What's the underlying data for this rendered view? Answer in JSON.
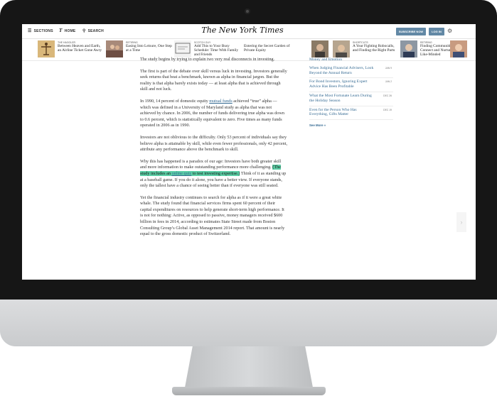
{
  "topbar": {
    "sections_label": "SECTIONS",
    "home_label": "HOME",
    "search_label": "SEARCH",
    "logo_text": "The New York Times",
    "subscribe_label": "SUBSCRIBE NOW",
    "login_label": "LOG IN"
  },
  "ribbon": [
    {
      "kicker": "THE HAGGLER",
      "headline": "Between Heaven and Earth, an Airline Ticket Gone Awry",
      "thumb_color": "#c9a66b"
    },
    {
      "kicker": "RETIRING",
      "headline": "Easing Into Leisure, One Step at a Time",
      "thumb_color": "#8a6a5c"
    },
    {
      "kicker": "SCOTCH GUY",
      "headline": "Add This to Your Busy Schedule: Time With Family and Friends",
      "thumb_color": "#d8d8d8"
    },
    {
      "kicker": "",
      "headline": "Entering the Secret Garden of Private Equity",
      "thumb_color": ""
    },
    {
      "kicker": "",
      "headline": "",
      "thumb_color": "#7b6a55"
    },
    {
      "kicker": "SHORTCUTS",
      "headline": "A Year Fighting Robocalls, and Finding the Right Parts",
      "thumb_color": "#9c8b7a"
    },
    {
      "kicker": "RETIRING",
      "headline": "Finding Communities That Connect and Nurture the Like-Minded",
      "thumb_color": "#7d8590"
    }
  ],
  "article": {
    "p1": "The study begins by trying to explain two very real disconnects in investing.",
    "p2": "The first is part of the debate over skill versus luck in investing. Investors generally seek returns that beat a benchmark, known as alpha in financial jargon. But the reality is that alpha barely exists today — at least alpha that is achieved through skill and not luck.",
    "p3_a": "In 1990, 14 percent of domestic equity ",
    "p3_link": "mutual funds",
    "p3_b": " achieved “true” alpha — which was defined in a University of Maryland study as alpha that was not achieved by chance. In 2006, the number of funds delivering true alpha was down to 0.6 percent, which is statistically equivalent to zero. Five times as many funds operated in 2006 as in 1990.",
    "p4": "Investors are not oblivious to the difficulty. Only 53 percent of individuals say they believe alpha is attainable by skill, while even fewer professionals, only 42 percent, attribute any performance above the benchmark to skill.",
    "p5_a": "Why this has happened is a paradox of our age: Investors have both greater skill and more information to make outstanding performance more challenging. ",
    "p5_hl_a": "(The study includes an ",
    "p5_hl_link": "online quiz",
    "p5_hl_b": " to test investing expertise.)",
    "p5_b": " Think of it as standing up at a baseball game. If you do it alone, you have a better view. If everyone stands, only the tallest have a chance of seeing better than if everyone was still seated.",
    "p6": "Yet the financial industry continues to search for alpha as if it were a great white whale. The study found that financial services firms spent 60 percent of their capital expenditures on resources to help generate short-term high performance. It is not for nothing: Active, as opposed to passive, money managers received $600 billion in fees in 2014, according to estimates State Street made from Boston Consulting Group’s Global Asset Management 2014 report. That amount is nearly equal to the gross domestic product of Switzerland."
  },
  "rail": {
    "top_fragment": "Money and Emotion",
    "items": [
      {
        "title": "When Judging Financial Advisers, Look Beyond the Annual Return",
        "date": "JAN 9"
      },
      {
        "title": "For Bond Investors, Ignoring Expert Advice Has Been Profitable",
        "date": "JAN 2"
      },
      {
        "title": "What the Most Fortunate Learn During the Holiday Season",
        "date": "DEC 26"
      },
      {
        "title": "Even for the Person Who Has Everything, Gifts Matter",
        "date": "DEC 19"
      }
    ],
    "see_more": "See More »"
  },
  "icons": {
    "menu": "menu-icon",
    "home": "nyt-logo-icon",
    "search": "search-icon",
    "settings": "gear-icon",
    "next": "chevron-right-icon"
  }
}
